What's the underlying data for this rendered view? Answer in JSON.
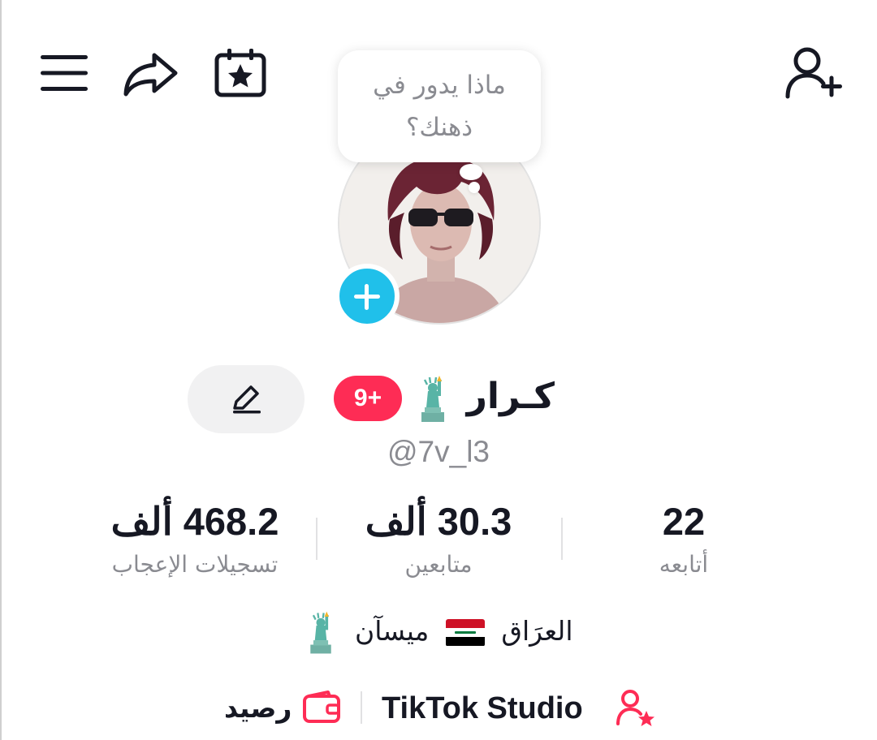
{
  "header": {
    "menu_icon": "hamburger-menu-icon",
    "share_icon": "share-arrow-icon",
    "calendar_icon": "calendar-star-icon",
    "add_friend_icon": "add-user-icon"
  },
  "bubble": {
    "text": "ماذا يدور في ذهنك؟"
  },
  "profile": {
    "name": "كـرار",
    "username": "@7v_l3",
    "notification_badge": "9+",
    "edit_icon": "pencil-icon",
    "add_story_icon": "plus-icon"
  },
  "stats": [
    {
      "value": "22",
      "label": "أتابعه"
    },
    {
      "value": "30.3 ألف",
      "label": "متابعين"
    },
    {
      "value": "468.2 ألف",
      "label": "تسجيلات الإعجاب"
    }
  ],
  "location": {
    "country": "العرَاق",
    "city": "ميسآن"
  },
  "bottom": {
    "studio_label": "TikTok Studio",
    "studio_icon": "user-star-icon",
    "balance_label": "رصيد",
    "wallet_icon": "wallet-icon"
  },
  "colors": {
    "accent_red": "#fe2c55",
    "add_blue": "#20c0ea",
    "muted_text": "#8a8b91"
  }
}
